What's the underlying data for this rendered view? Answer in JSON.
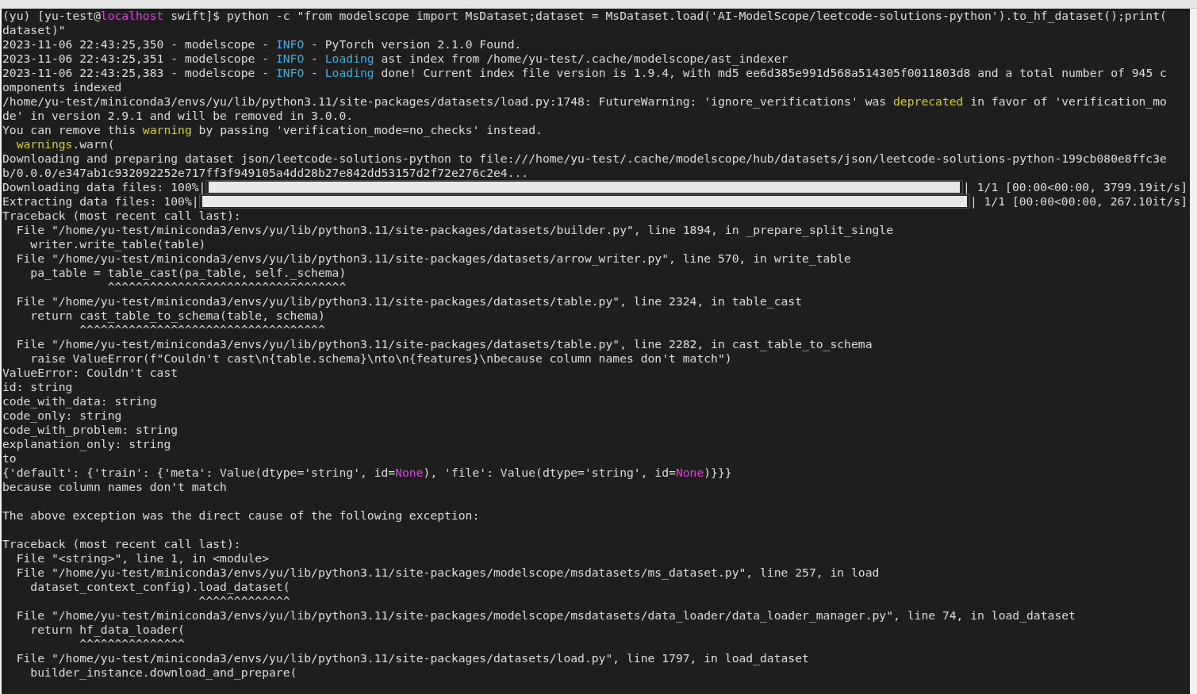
{
  "lines": [
    {
      "kind": "text",
      "segments": [
        {
          "text": "(yu) [yu-test@"
        },
        {
          "text": "localhost",
          "color": "#e040e0"
        },
        {
          "text": " swift]$ python -c \"from modelscope import MsDataset;dataset = MsDataset.load('AI-ModelScope/leetcode-solutions-python').to_hf_dataset();print("
        }
      ]
    },
    {
      "kind": "text",
      "segments": [
        {
          "text": "dataset)\""
        }
      ]
    },
    {
      "kind": "text",
      "segments": [
        {
          "text": "2023-11-06 22:43:25,350 - modelscope - "
        },
        {
          "text": "INFO",
          "color": "#3bb0e0"
        },
        {
          "text": " - PyTorch version 2.1.0 Found."
        }
      ]
    },
    {
      "kind": "text",
      "segments": [
        {
          "text": "2023-11-06 22:43:25,351 - modelscope - "
        },
        {
          "text": "INFO",
          "color": "#3bb0e0"
        },
        {
          "text": " - "
        },
        {
          "text": "Loading",
          "color": "#3bb0e0"
        },
        {
          "text": " ast index from /home/yu-test/.cache/modelscope/ast_indexer"
        }
      ]
    },
    {
      "kind": "text",
      "segments": [
        {
          "text": "2023-11-06 22:43:25,383 - modelscope - "
        },
        {
          "text": "INFO",
          "color": "#3bb0e0"
        },
        {
          "text": " - "
        },
        {
          "text": "Loading",
          "color": "#3bb0e0"
        },
        {
          "text": " done! Current index file version is 1.9.4, with md5 ee6d385e991d568a514305f0011803d8 and a total number of 945 c"
        }
      ]
    },
    {
      "kind": "text",
      "segments": [
        {
          "text": "omponents indexed"
        }
      ]
    },
    {
      "kind": "text",
      "segments": [
        {
          "text": "/home/yu-test/miniconda3/envs/yu/lib/python3.11/site-packages/datasets/load.py:1748: FutureWarning: 'ignore_verifications' was "
        },
        {
          "text": "deprecated",
          "color": "#d0d020"
        },
        {
          "text": " in favor of 'verification_mo"
        }
      ]
    },
    {
      "kind": "text",
      "segments": [
        {
          "text": "de' in version 2.9.1 and will be removed in 3.0.0."
        }
      ]
    },
    {
      "kind": "text",
      "segments": [
        {
          "text": "You can remove this "
        },
        {
          "text": "warning",
          "color": "#d0d020"
        },
        {
          "text": " by passing 'verification_mode=no_checks' instead."
        }
      ]
    },
    {
      "kind": "text",
      "segments": [
        {
          "text": "  warnings",
          "color": "#d0d020"
        },
        {
          "text": ".warn("
        }
      ]
    },
    {
      "kind": "text",
      "segments": [
        {
          "text": "Downloading and preparing dataset json/leetcode-solutions-python to file:///home/yu-test/.cache/modelscope/hub/datasets/json/leetcode-solutions-python-199cb080e8ffc3e"
        }
      ]
    },
    {
      "kind": "text",
      "segments": [
        {
          "text": "b/0.0.0/e347ab1c932092252e717ff3f949105a4dd28b27e842dd53157d2f72e276c2e4..."
        }
      ]
    },
    {
      "kind": "progress",
      "label": "Downloading data files: 100%|",
      "level": 1,
      "readout": "| 1/1 [00:00<00:00, 3799.19it/s]"
    },
    {
      "kind": "progress",
      "label": "Extracting data files: 100%|",
      "level": 1,
      "readout": "| 1/1 [00:00<00:00, 267.10it/s]"
    },
    {
      "kind": "text",
      "segments": [
        {
          "text": "Traceback (most recent call last):"
        }
      ]
    },
    {
      "kind": "text",
      "segments": [
        {
          "text": "  File \"/home/yu-test/miniconda3/envs/yu/lib/python3.11/site-packages/datasets/builder.py\", line 1894, in _prepare_split_single"
        }
      ]
    },
    {
      "kind": "text",
      "segments": [
        {
          "text": "    writer.write_table(table)"
        }
      ]
    },
    {
      "kind": "text",
      "segments": [
        {
          "text": "  File \"/home/yu-test/miniconda3/envs/yu/lib/python3.11/site-packages/datasets/arrow_writer.py\", line 570, in write_table"
        }
      ]
    },
    {
      "kind": "text",
      "segments": [
        {
          "text": "    pa_table = table_cast(pa_table, self._schema)"
        }
      ]
    },
    {
      "kind": "caret",
      "segments": [
        {
          "text": "               ^^^^^^^^^^^^^^^^^^^^^^^^^^^^^^^^^^"
        }
      ]
    },
    {
      "kind": "text",
      "segments": [
        {
          "text": "  File \"/home/yu-test/miniconda3/envs/yu/lib/python3.11/site-packages/datasets/table.py\", line 2324, in table_cast"
        }
      ]
    },
    {
      "kind": "text",
      "segments": [
        {
          "text": "    return cast_table_to_schema(table, schema)"
        }
      ]
    },
    {
      "kind": "caret",
      "segments": [
        {
          "text": "           ^^^^^^^^^^^^^^^^^^^^^^^^^^^^^^^^^^^"
        }
      ]
    },
    {
      "kind": "text",
      "segments": [
        {
          "text": "  File \"/home/yu-test/miniconda3/envs/yu/lib/python3.11/site-packages/datasets/table.py\", line 2282, in cast_table_to_schema"
        }
      ]
    },
    {
      "kind": "text",
      "segments": [
        {
          "text": "    raise ValueError(f\"Couldn't cast\\n{table.schema}\\nto\\n{features}\\nbecause column names don't match\")"
        }
      ]
    },
    {
      "kind": "text",
      "segments": [
        {
          "text": "ValueError: Couldn't cast"
        }
      ]
    },
    {
      "kind": "text",
      "segments": [
        {
          "text": "id: string"
        }
      ]
    },
    {
      "kind": "text",
      "segments": [
        {
          "text": "code_with_data: string"
        }
      ]
    },
    {
      "kind": "text",
      "segments": [
        {
          "text": "code_only: string"
        }
      ]
    },
    {
      "kind": "text",
      "segments": [
        {
          "text": "code_with_problem: string"
        }
      ]
    },
    {
      "kind": "text",
      "segments": [
        {
          "text": "explanation_only: string"
        }
      ]
    },
    {
      "kind": "text",
      "segments": [
        {
          "text": "to"
        }
      ]
    },
    {
      "kind": "text",
      "segments": [
        {
          "text": "{'default': {'train': {'meta': Value(dtype='string', id="
        },
        {
          "text": "None",
          "color": "#e040e0"
        },
        {
          "text": "), 'file': Value(dtype='string', id="
        },
        {
          "text": "None",
          "color": "#e040e0"
        },
        {
          "text": ")}}}"
        }
      ]
    },
    {
      "kind": "text",
      "segments": [
        {
          "text": "because column names don't match"
        }
      ]
    },
    {
      "kind": "blank"
    },
    {
      "kind": "text",
      "segments": [
        {
          "text": "The above exception was the direct cause of the following exception:"
        }
      ]
    },
    {
      "kind": "blank"
    },
    {
      "kind": "text",
      "segments": [
        {
          "text": "Traceback (most recent call last):"
        }
      ]
    },
    {
      "kind": "text",
      "segments": [
        {
          "text": "  File \"<string>\", line 1, in <module>"
        }
      ]
    },
    {
      "kind": "text",
      "segments": [
        {
          "text": "  File \"/home/yu-test/miniconda3/envs/yu/lib/python3.11/site-packages/modelscope/msdatasets/ms_dataset.py\", line 257, in load"
        }
      ]
    },
    {
      "kind": "text",
      "segments": [
        {
          "text": "    dataset_context_config).load_dataset("
        }
      ]
    },
    {
      "kind": "caret",
      "segments": [
        {
          "text": "                            ^^^^^^^^^^^^^"
        }
      ]
    },
    {
      "kind": "text",
      "segments": [
        {
          "text": "  File \"/home/yu-test/miniconda3/envs/yu/lib/python3.11/site-packages/modelscope/msdatasets/data_loader/data_loader_manager.py\", line 74, in load_dataset"
        }
      ]
    },
    {
      "kind": "text",
      "segments": [
        {
          "text": "    return hf_data_loader("
        }
      ]
    },
    {
      "kind": "caret",
      "segments": [
        {
          "text": "           ^^^^^^^^^^^^^^^"
        }
      ]
    },
    {
      "kind": "text",
      "segments": [
        {
          "text": "  File \"/home/yu-test/miniconda3/envs/yu/lib/python3.11/site-packages/datasets/load.py\", line 1797, in load_dataset"
        }
      ]
    },
    {
      "kind": "text",
      "segments": [
        {
          "text": "    builder_instance.download_and_prepare("
        }
      ]
    }
  ]
}
